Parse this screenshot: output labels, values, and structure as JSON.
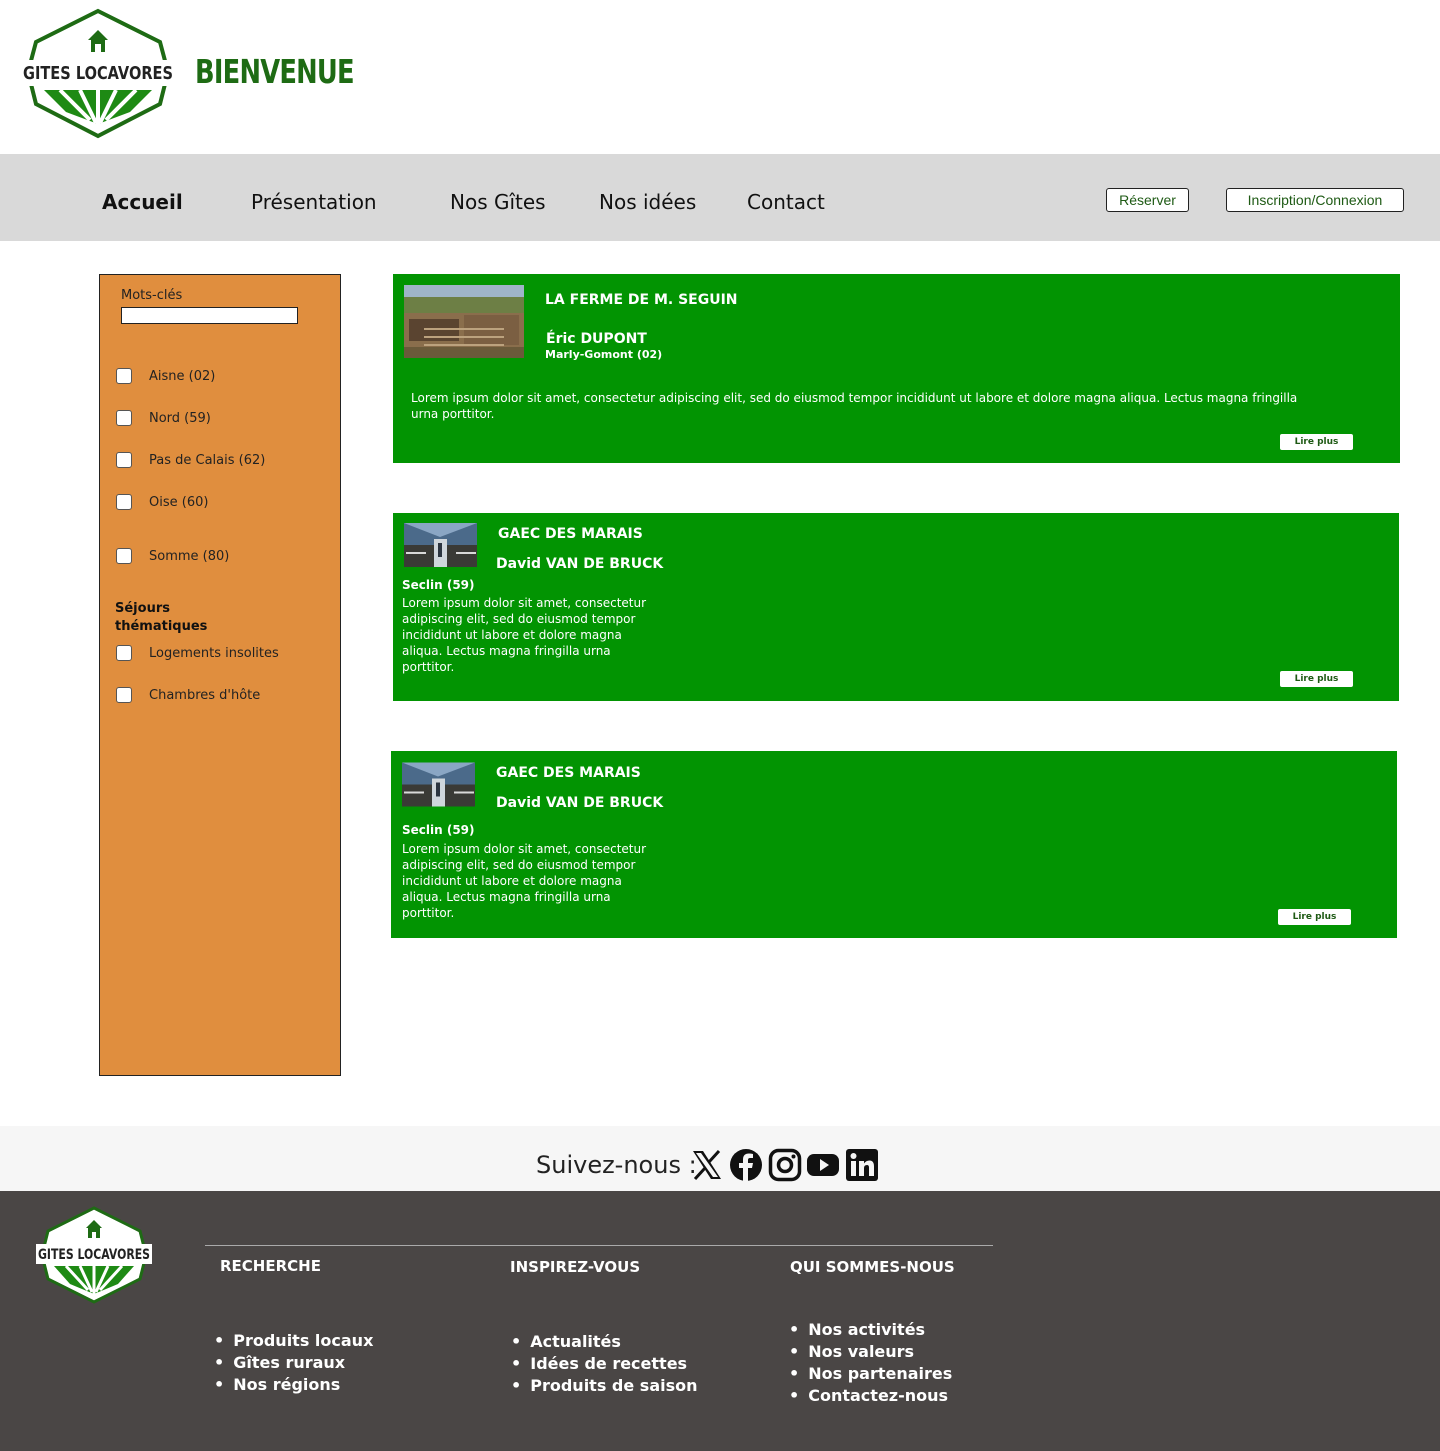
{
  "header": {
    "logo_text": "GITES LOCAVORES",
    "welcome": "BIENVENUE"
  },
  "nav": {
    "items": [
      {
        "label": "Accueil",
        "active": true
      },
      {
        "label": "Présentation"
      },
      {
        "label": "Nos Gîtes"
      },
      {
        "label": "Nos idées"
      },
      {
        "label": "Contact"
      }
    ],
    "reserve_button": "Réserver",
    "login_button": "Inscription/Connexion"
  },
  "sidebar": {
    "keywords_label": "Mots-clés",
    "keywords_value": "",
    "departments": [
      {
        "label": "Aisne (02)",
        "checked": false
      },
      {
        "label": "Nord (59)",
        "checked": false
      },
      {
        "label": "Pas de Calais (62)",
        "checked": false
      },
      {
        "label": "Oise (60)",
        "checked": false
      },
      {
        "label": "Somme (80)",
        "checked": false
      }
    ],
    "themes_heading_line1": "Séjours",
    "themes_heading_line2": "thématiques",
    "themes": [
      {
        "label": "Logements insolites",
        "checked": false
      },
      {
        "label": "Chambres d'hôte",
        "checked": false
      }
    ]
  },
  "cards": [
    {
      "title": "LA FERME DE M. SEGUIN",
      "owner": "Éric DUPONT",
      "location": "Marly-Gomont (02)",
      "description": "Lorem ipsum dolor sit amet, consectetur adipiscing elit, sed do eiusmod tempor incididunt ut labore et dolore magna aliqua. Lectus magna fringilla urna porttitor.",
      "button": "Lire plus"
    },
    {
      "title": "GAEC DES MARAIS",
      "owner": "David VAN DE BRUCK",
      "location": "Seclin (59)",
      "description": "Lorem ipsum dolor sit amet, consectetur adipiscing elit, sed do eiusmod tempor incididunt ut labore et dolore magna aliqua. Lectus magna fringilla urna porttitor.",
      "button": "Lire plus"
    },
    {
      "title": "GAEC DES MARAIS",
      "owner": "David VAN DE BRUCK",
      "location": "Seclin (59)",
      "description": "Lorem ipsum dolor sit amet, consectetur adipiscing elit, sed do eiusmod tempor incididunt ut labore et dolore magna aliqua. Lectus magna fringilla urna porttitor.",
      "button": "Lire plus"
    }
  ],
  "follow": {
    "label": "Suivez-nous :",
    "icons": [
      "x-icon",
      "facebook-icon",
      "instagram-icon",
      "youtube-icon",
      "linkedin-icon"
    ]
  },
  "footer": {
    "logo_text": "GITES LOCAVORES",
    "columns": [
      {
        "heading": "RECHERCHE",
        "links": [
          "Produits locaux",
          "Gîtes ruraux",
          "Nos régions"
        ]
      },
      {
        "heading": "INSPIREZ-VOUS",
        "links": [
          "Actualités",
          "Idées de recettes",
          "Produits de saison"
        ]
      },
      {
        "heading": "QUI SOMMES-NOUS",
        "links": [
          "Nos activités",
          "Nos valeurs",
          "Nos partenaires",
          "Contactez-nous"
        ]
      }
    ]
  },
  "colors": {
    "brand_green": "#1e6b14",
    "card_green": "#029402",
    "sidebar_orange": "#e08e3e",
    "nav_gray": "#d9d9d9",
    "footer_dark": "#4a4645"
  }
}
